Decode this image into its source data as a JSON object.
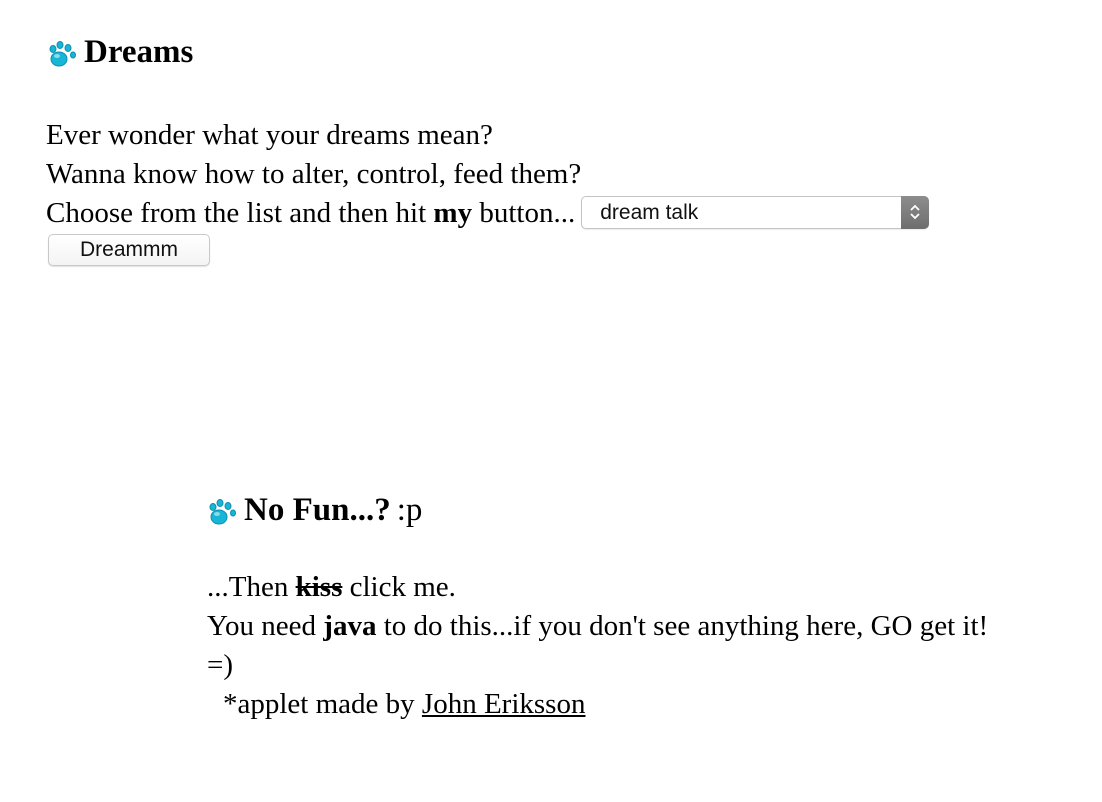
{
  "dreams": {
    "title": "Dreams",
    "line1": "Ever wonder what your dreams mean?",
    "line2": "Wanna know how to alter, control, feed them?",
    "line3_prefix": "Choose from the list and then hit ",
    "line3_bold": "my",
    "line3_suffix": " button...",
    "select_value": "dream talk",
    "button_label": "Dreammm"
  },
  "nofun": {
    "title": "No Fun...?",
    "title_suffix": ":p",
    "line1_prefix": "...Then ",
    "line1_strike": "kiss",
    "line1_suffix": " click me.",
    "line2_prefix": "You need ",
    "line2_bold": "java",
    "line2_suffix": " to do this...if you don't see anything here, GO get it!",
    "line3": "=)",
    "credit_prefix": "*applet made by ",
    "credit_link": "John Eriksson"
  },
  "icons": {
    "title_icon": "paw-print-icon",
    "select_icon": "up-down-arrows-icon"
  },
  "colors": {
    "paw": "#18b6d6",
    "paw_dark": "#0b8fb0",
    "select_arrow_bg": "#7c7c7c",
    "text": "#000000"
  }
}
